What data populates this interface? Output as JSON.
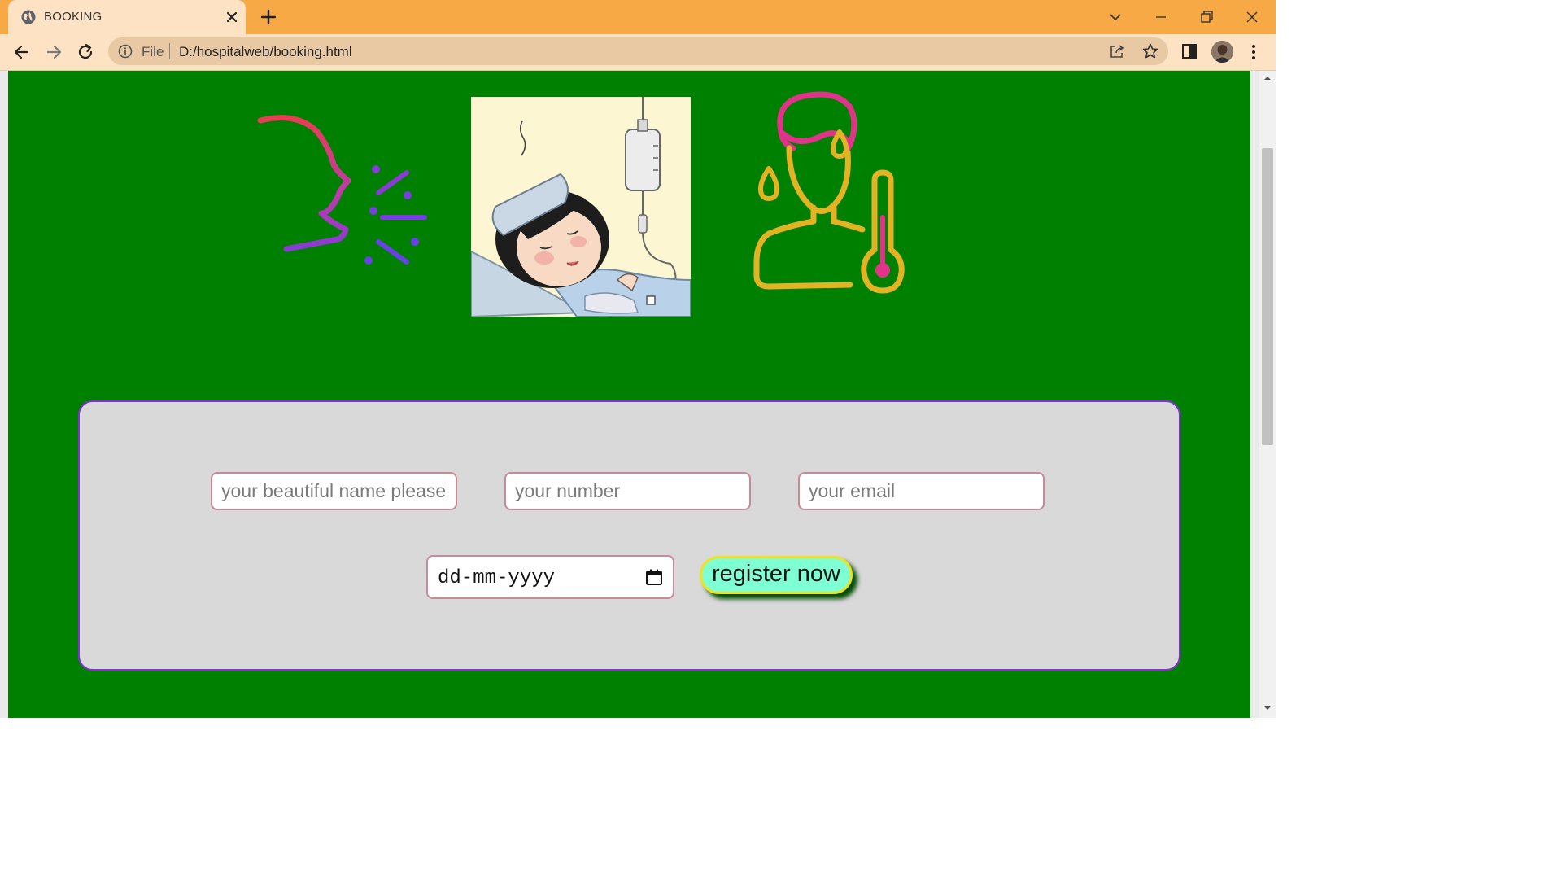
{
  "browser": {
    "tab_title": "BOOKING",
    "omnibox": {
      "scheme_label": "File",
      "url": "D:/hospitalweb/booking.html"
    }
  },
  "colors": {
    "titlebar": "#f7a946",
    "toolbar": "#fde2c3",
    "page_background": "#008000",
    "card_background": "#d9d9d9",
    "card_border": "#8a2be2",
    "input_border": "#c98a95",
    "button_background": "#7fffd4",
    "button_border": "#f1e21b"
  },
  "icons": {
    "tab": "globe-icon",
    "close": "close-icon",
    "new_tab": "plus-icon",
    "back": "back-arrow-icon",
    "forward": "forward-arrow-icon",
    "reload": "reload-icon",
    "site_info": "info-icon",
    "share": "share-icon",
    "bookmark": "star-icon",
    "side_panel": "side-panel-icon",
    "menu": "kebab-menu-icon",
    "date_picker": "calendar-icon"
  },
  "illustrations": [
    "cough-icon",
    "sick-patient-image",
    "fever-icon"
  ],
  "form": {
    "name_placeholder": "your beautiful name please",
    "number_placeholder": "your number",
    "email_placeholder": "your email",
    "date_placeholder": "dd-mm-yyyy",
    "submit_label": "register now"
  }
}
